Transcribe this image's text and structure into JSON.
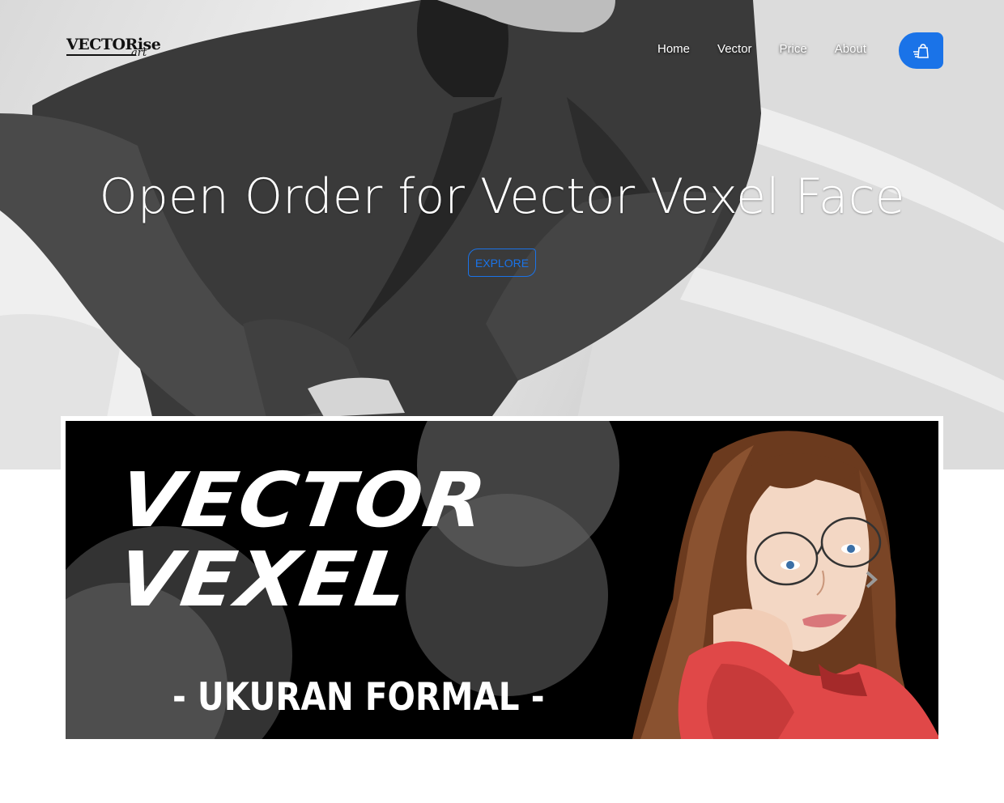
{
  "nav": {
    "logo_text": "VECTORise",
    "logo_sub": "art",
    "items": [
      {
        "label": "Home"
      },
      {
        "label": "Vector"
      },
      {
        "label": "Price"
      },
      {
        "label": "About"
      }
    ],
    "cart_icon": "hand-bag-icon",
    "accent_color": "#1a73e8"
  },
  "hero": {
    "title": "Open Order for Vector Vexel Face",
    "button_label": "EXPLORE"
  },
  "banner": {
    "line1": "VECTOR",
    "line2": "VEXEL",
    "subtitle": "- UKURAN FORMAL -",
    "next_icon": "chevron-right-icon"
  }
}
